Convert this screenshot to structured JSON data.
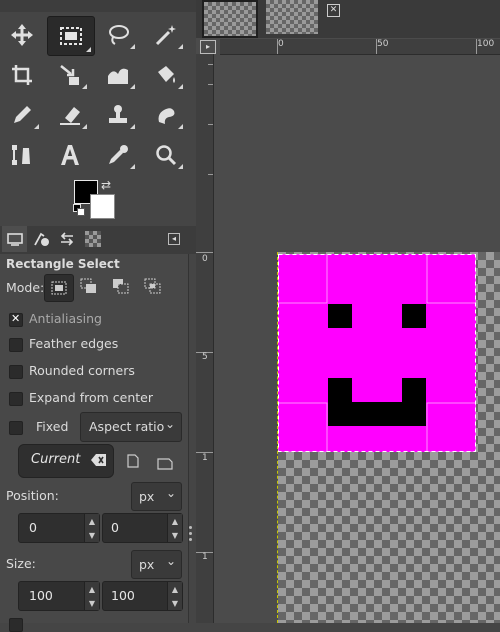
{
  "tool_options": {
    "title": "Rectangle Select",
    "mode_label": "Mode:",
    "antialiasing": "Antialiasing",
    "feather_edges": "Feather edges",
    "rounded_corners": "Rounded corners",
    "expand_from_center": "Expand from center",
    "fixed_label": "Fixed",
    "fixed_mode": "Aspect ratio",
    "current_value": "Current",
    "position_label": "Position:",
    "position_unit": "px",
    "position_x": "0",
    "position_y": "0",
    "size_label": "Size:",
    "size_unit": "px",
    "size_w": "100",
    "size_h": "100"
  },
  "rulers": {
    "h": [
      "0",
      "50",
      "100"
    ],
    "v": [
      "0",
      "5",
      "1",
      "1"
    ]
  },
  "colors": {
    "foreground": "#000000",
    "background": "#ffffff",
    "shape_fill": "#ff00ff"
  },
  "icons": [
    "move-icon",
    "rect-select-icon",
    "lasso-icon",
    "fuzzy-select-icon",
    "crop-icon",
    "unified-transform-icon",
    "warp-icon",
    "bucket-fill-icon",
    "pencil-icon",
    "eraser-icon",
    "clone-icon",
    "smudge-icon",
    "paths-icon",
    "text-icon",
    "color-picker-icon",
    "zoom-icon"
  ]
}
